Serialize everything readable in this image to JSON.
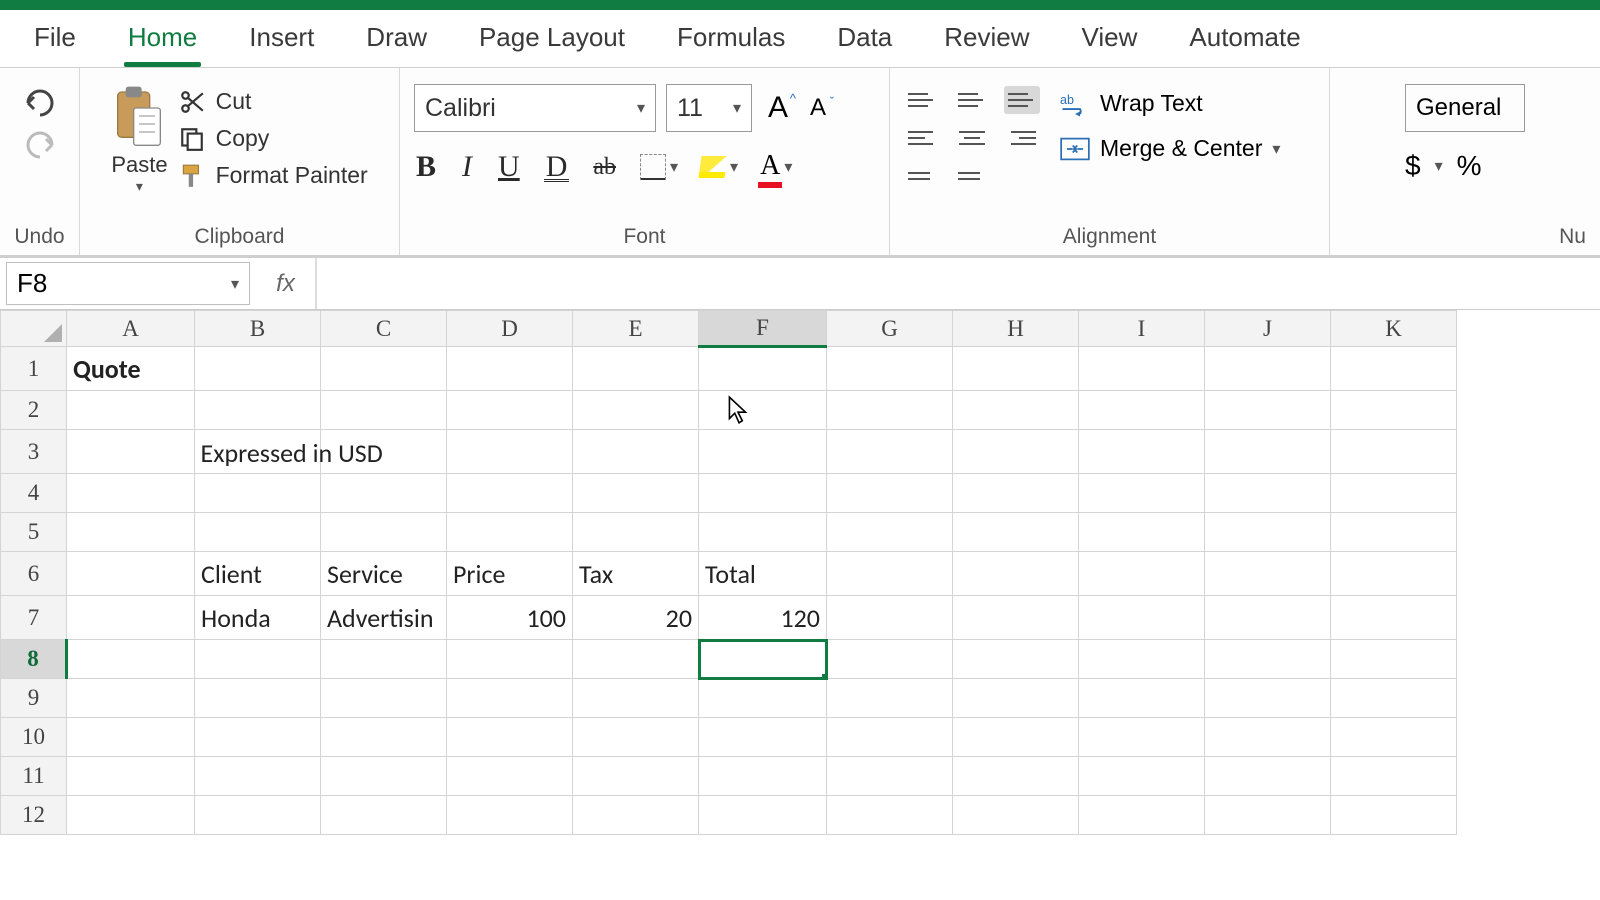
{
  "tabs": {
    "file": "File",
    "home": "Home",
    "insert": "Insert",
    "draw": "Draw",
    "pagelayout": "Page Layout",
    "formulas": "Formulas",
    "data": "Data",
    "review": "Review",
    "view": "View",
    "automate": "Automate"
  },
  "ribbon": {
    "undo_group": "Undo",
    "clipboard_group": "Clipboard",
    "font_group": "Font",
    "alignment_group": "Alignment",
    "number_group": "Nu",
    "paste": "Paste",
    "cut": "Cut",
    "copy": "Copy",
    "format_painter": "Format Painter",
    "font_name": "Calibri",
    "font_size": "11",
    "wrap_text": "Wrap Text",
    "merge_center": "Merge & Center",
    "number_format": "General",
    "currency": "$",
    "percent": "%"
  },
  "formula_bar": {
    "name_box": "F8",
    "fx": "fx",
    "formula": ""
  },
  "grid": {
    "columns": [
      "A",
      "B",
      "C",
      "D",
      "E",
      "F",
      "G",
      "H",
      "I",
      "J",
      "K"
    ],
    "active_col": "F",
    "active_row": 8,
    "rows": 12,
    "cells": {
      "A1": "Quote",
      "B3": "Expressed in USD",
      "B6": "Client",
      "C6": "Service",
      "D6": "Price",
      "E6": "Tax",
      "F6": "Total",
      "B7": "Honda",
      "C7": "Advertisin",
      "D7": "100",
      "E7": "20",
      "F7": "120"
    }
  }
}
